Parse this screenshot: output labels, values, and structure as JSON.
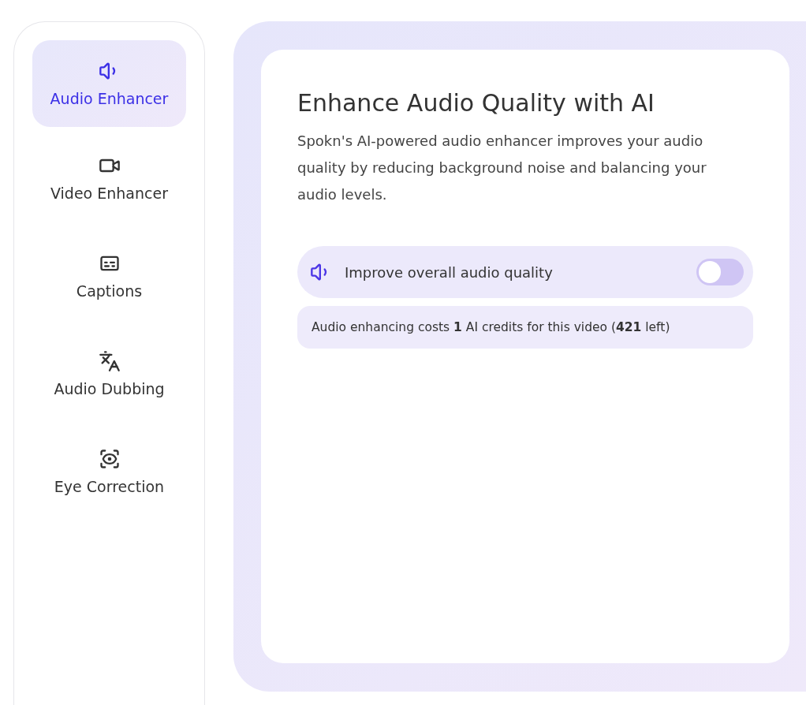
{
  "sidebar": {
    "items": [
      {
        "label": "Audio Enhancer",
        "selected": true
      },
      {
        "label": "Video Enhancer",
        "selected": false
      },
      {
        "label": "Captions",
        "selected": false
      },
      {
        "label": "Audio Dubbing",
        "selected": false
      },
      {
        "label": "Eye Correction",
        "selected": false
      }
    ]
  },
  "panel": {
    "title": "Enhance Audio Quality with AI",
    "description": "Spokn's AI-powered audio enhancer improves your audio quality by reducing background noise and balancing your audio levels.",
    "option": {
      "label": "Improve overall audio quality",
      "on": false
    },
    "note": "Audio enhancing costs **1** AI credits for this video (**421** left)"
  }
}
